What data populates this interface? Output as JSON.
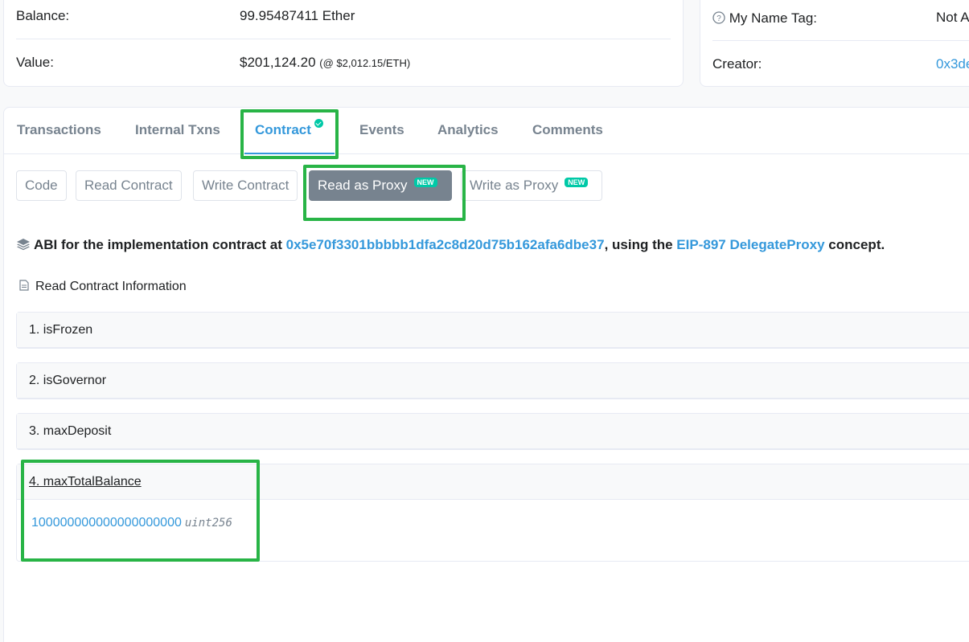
{
  "overview": {
    "balance_label": "Balance:",
    "balance_value": "99.95487411 Ether",
    "value_label": "Value:",
    "value_amount": "$201,124.20",
    "value_rate": "(@ $2,012.15/ETH)"
  },
  "more_info": {
    "name_tag_label": "My Name Tag:",
    "name_tag_value": "Not A",
    "creator_label": "Creator:",
    "creator_value": "0x3de"
  },
  "tabs": [
    {
      "label": "Transactions"
    },
    {
      "label": "Internal Txns"
    },
    {
      "label": "Contract"
    },
    {
      "label": "Events"
    },
    {
      "label": "Analytics"
    },
    {
      "label": "Comments"
    }
  ],
  "subtabs": [
    {
      "label": "Code"
    },
    {
      "label": "Read Contract"
    },
    {
      "label": "Write Contract"
    },
    {
      "label": "Read as Proxy",
      "badge": "NEW"
    },
    {
      "label": "Write as Proxy",
      "badge": "NEW"
    }
  ],
  "abi": {
    "prefix": "ABI for the implementation contract at",
    "address": "0x5e70f3301bbbbb1dfa2c8d20d75b162afa6dbe37",
    "middle": ", using the",
    "eip_link": "EIP-897 DelegateProxy",
    "suffix": "concept."
  },
  "read_info_label": "Read Contract Information",
  "functions": [
    {
      "label": "1. isFrozen"
    },
    {
      "label": "2. isGovernor"
    },
    {
      "label": "3. maxDeposit"
    },
    {
      "label": "4. maxTotalBalance",
      "result_value": "100000000000000000000",
      "result_type": "uint256"
    }
  ],
  "colors": {
    "link": "#3498db",
    "highlight": "#28b446",
    "badge": "#00c9a7",
    "muted": "#77838f"
  }
}
